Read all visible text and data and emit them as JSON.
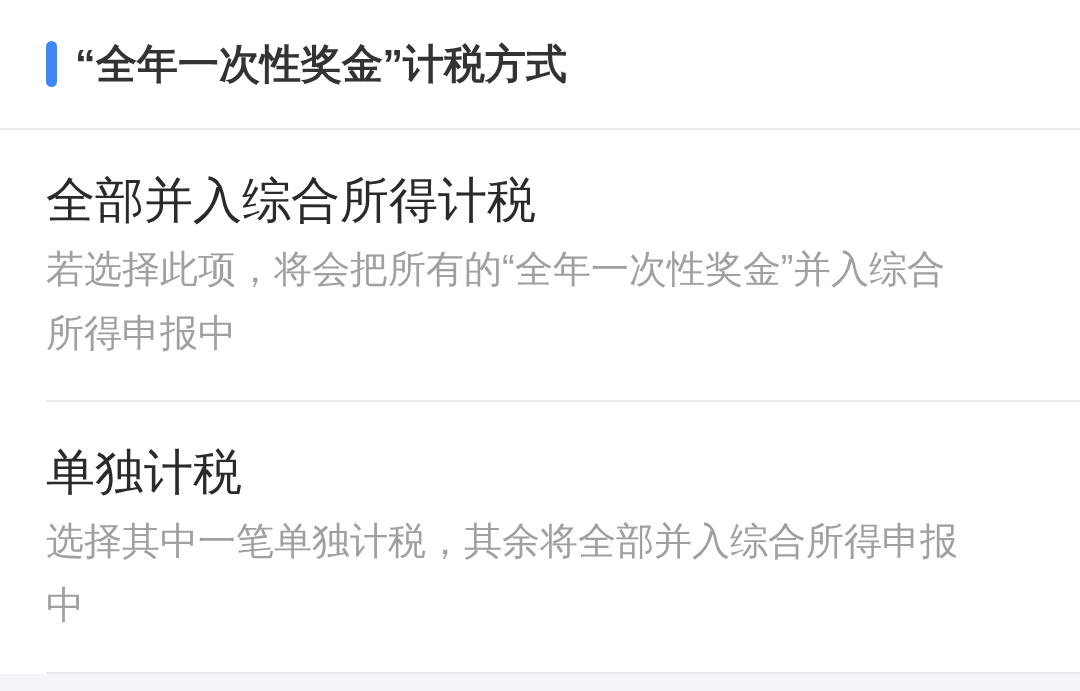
{
  "section": {
    "title": "“全年一次性奖金”计税方式"
  },
  "options": [
    {
      "title": "全部并入综合所得计税",
      "description": "若选择此项，将会把所有的“全年一次性奖金”并入综合所得申报中"
    },
    {
      "title": "单独计税",
      "description": "选择其中一笔单独计税，其余将全部并入综合所得申报中"
    }
  ]
}
